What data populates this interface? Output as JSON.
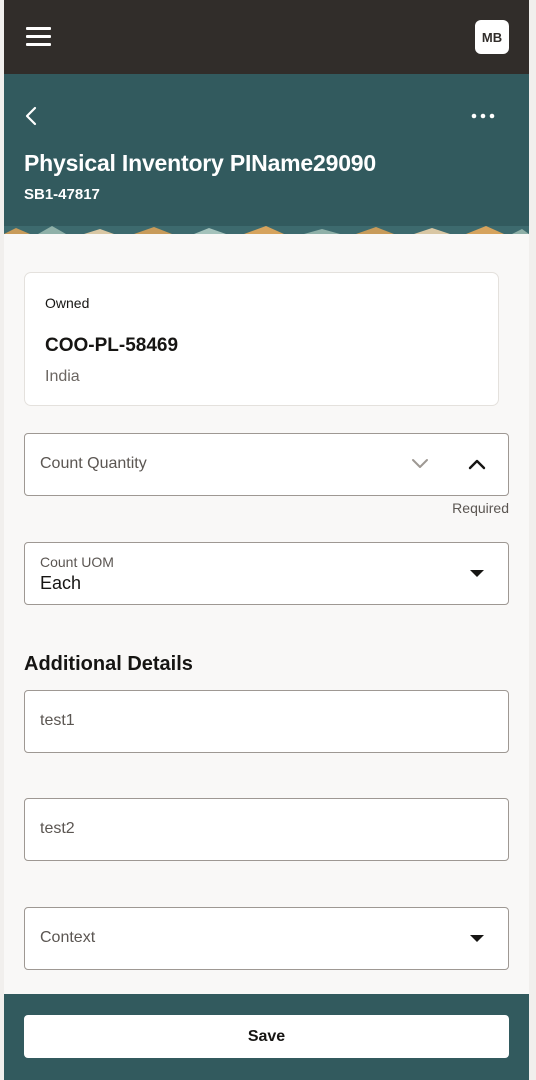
{
  "topbar": {
    "avatar_initials": "MB",
    "menu_icon": "hamburger-menu-icon"
  },
  "header": {
    "title": "Physical Inventory PIName29090",
    "subtitle": "SB1-47817",
    "back_icon": "chevron-left-icon",
    "more_icon": "more-horizontal-icon",
    "background_color": "#325a5e"
  },
  "card": {
    "status": "Owned",
    "code": "COO-PL-58469",
    "country": "India"
  },
  "form": {
    "count_quantity": {
      "placeholder": "Count Quantity",
      "helper": "Required"
    },
    "count_uom": {
      "label": "Count UOM",
      "value": "Each"
    },
    "additional_details_title": "Additional Details",
    "test1": {
      "placeholder": "test1"
    },
    "test2": {
      "placeholder": "test2"
    },
    "context": {
      "placeholder": "Context"
    }
  },
  "footer": {
    "save_label": "Save"
  },
  "colors": {
    "topbar": "#312d2a",
    "accent": "#325a5e",
    "page_bg": "#f9f8f7"
  }
}
